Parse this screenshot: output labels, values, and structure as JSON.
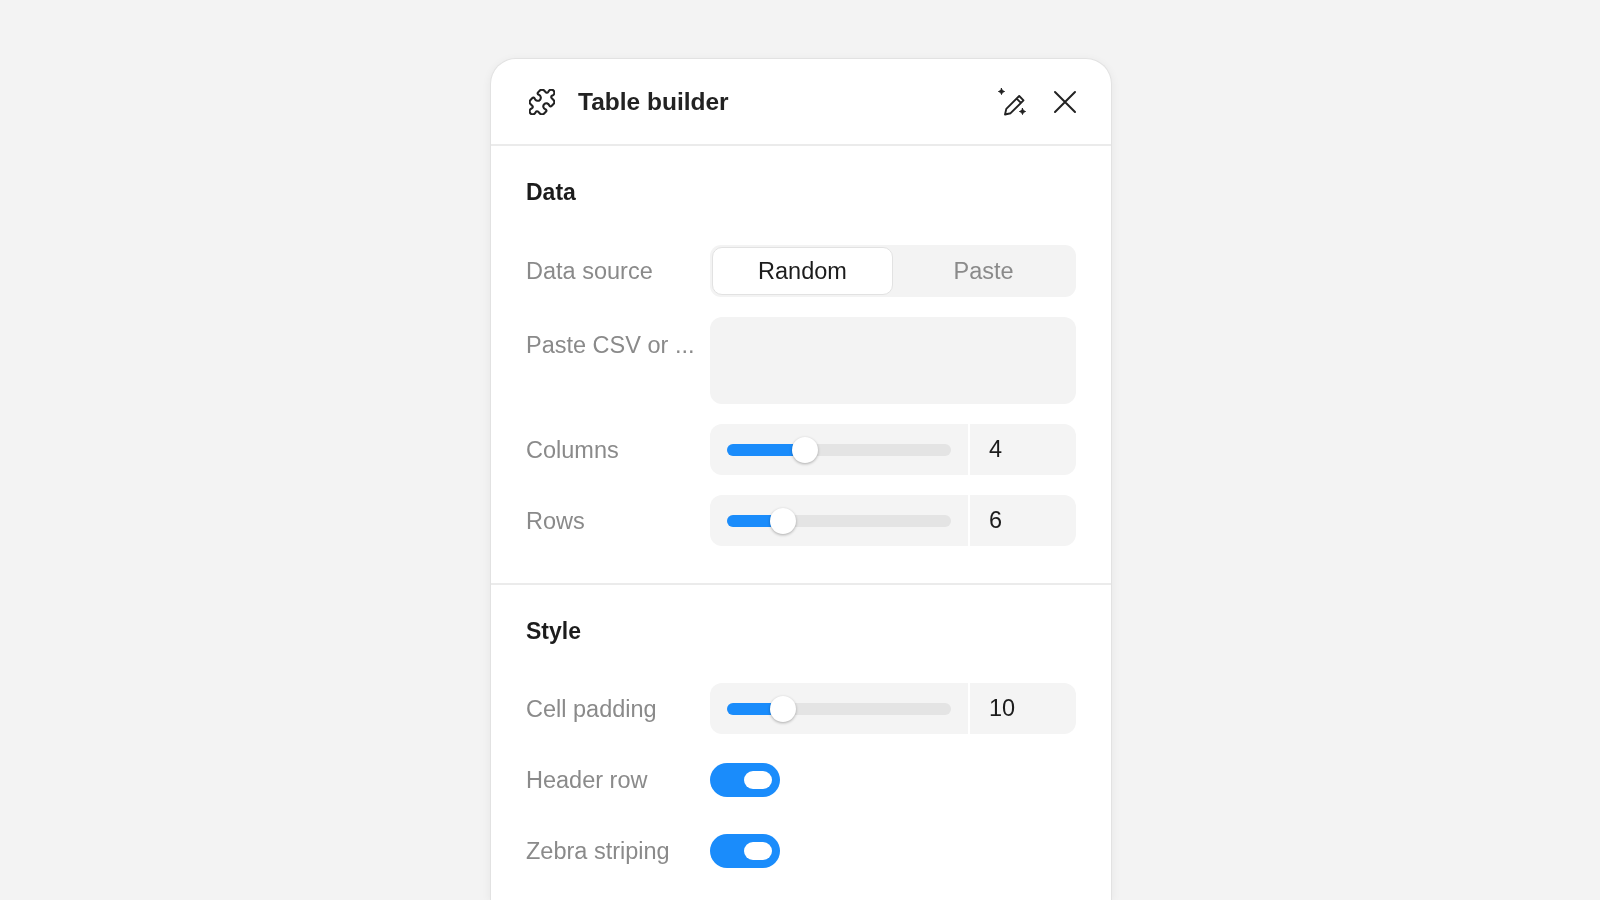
{
  "panel": {
    "title": "Table builder"
  },
  "sections": [
    {
      "heading": "Data",
      "controls": [
        {
          "kind": "segmented",
          "label": "Data source",
          "options": [
            {
              "label": "Random",
              "selected": true
            },
            {
              "label": "Paste",
              "selected": false
            }
          ]
        },
        {
          "kind": "textarea",
          "label": "Paste CSV or ..."
        },
        {
          "kind": "slider",
          "label": "Columns",
          "level": 0.35,
          "value": "4"
        },
        {
          "kind": "slider",
          "label": "Rows",
          "level": 0.25,
          "value": "6"
        }
      ]
    },
    {
      "heading": "Style",
      "controls": [
        {
          "kind": "slider",
          "label": "Cell padding",
          "level": 0.25,
          "value": "10"
        },
        {
          "kind": "toggle",
          "label": "Header row",
          "on": true
        },
        {
          "kind": "toggle",
          "label": "Zebra striping",
          "on": true
        }
      ]
    }
  ]
}
